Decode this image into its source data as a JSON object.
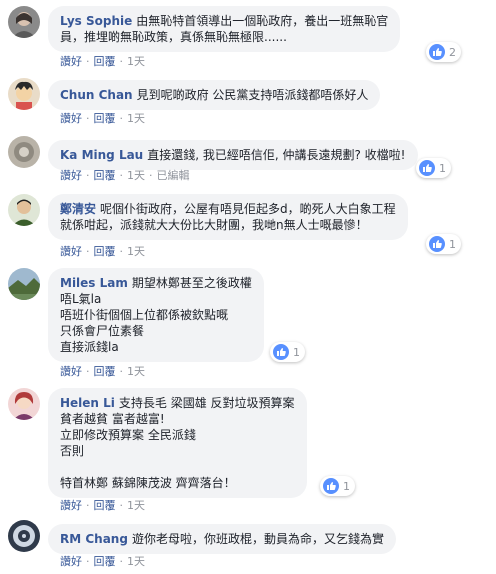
{
  "comments": [
    {
      "author": "Lys Sophie",
      "lines": [
        "由無恥特首領導出一個恥政府，養出一班無恥官",
        "員，推埋啲無恥政策，真係無恥無極限......"
      ],
      "actions": {
        "like": "讚好",
        "reply": "回覆",
        "time": "1天"
      },
      "reactions": "2"
    },
    {
      "author": "Chun Chan",
      "lines": [
        "見到呢啲政府 公民黨支持唔派錢都唔係好人"
      ],
      "actions": {
        "like": "讚好",
        "reply": "回覆",
        "time": "1天"
      }
    },
    {
      "author": "Ka Ming Lau",
      "lines": [
        "直接還錢, 我已經唔信佢, 仲講長遠規劃? 收檔啦!"
      ],
      "actions": {
        "like": "讚好",
        "reply": "回覆",
        "time": "1天",
        "edited": "已編輯"
      },
      "reactions": "1"
    },
    {
      "author": "鄭清安",
      "lines": [
        "呢個仆街政府，公屋有唔見佢起多d，啲死人大白象工程",
        "就係咁起，派錢就大大份比大財團，我哋n無人士嘅最慘！"
      ],
      "actions": {
        "like": "讚好",
        "reply": "回覆",
        "time": "1天"
      },
      "reactions": "1"
    },
    {
      "author": "Miles Lam",
      "lines": [
        "期望林鄭甚至之後政權",
        "唔L氣la",
        "唔班仆街個個上位都係被欽點嘅",
        "只係會尸位素餐",
        "直接派錢la"
      ],
      "actions": {
        "like": "讚好",
        "reply": "回覆",
        "time": "1天"
      },
      "reactions": "1"
    },
    {
      "author": "Helen Li",
      "lines": [
        "支持長毛 梁國雄 反對垃圾預算案",
        "貧者越貧 富者越富!",
        "立即修改預算案 全民派錢",
        "否則",
        "",
        "特首林鄭 蘇錦陳茂波 齊齊落台！"
      ],
      "actions": {
        "like": "讚好",
        "reply": "回覆",
        "time": "1天"
      },
      "reactions": "1"
    },
    {
      "author": "RM Chang",
      "lines": [
        "遊你老母啦，你班政棍，動員為命，又乞錢為實"
      ],
      "actions": {
        "like": "讚好",
        "reply": "回覆",
        "time": "1天"
      }
    }
  ],
  "colors": {
    "author": "#385898",
    "bubble": "#f2f3f5",
    "meta": "#90949c",
    "like": "#5890ff"
  },
  "icons": {
    "reaction": "like-thumb-icon"
  }
}
